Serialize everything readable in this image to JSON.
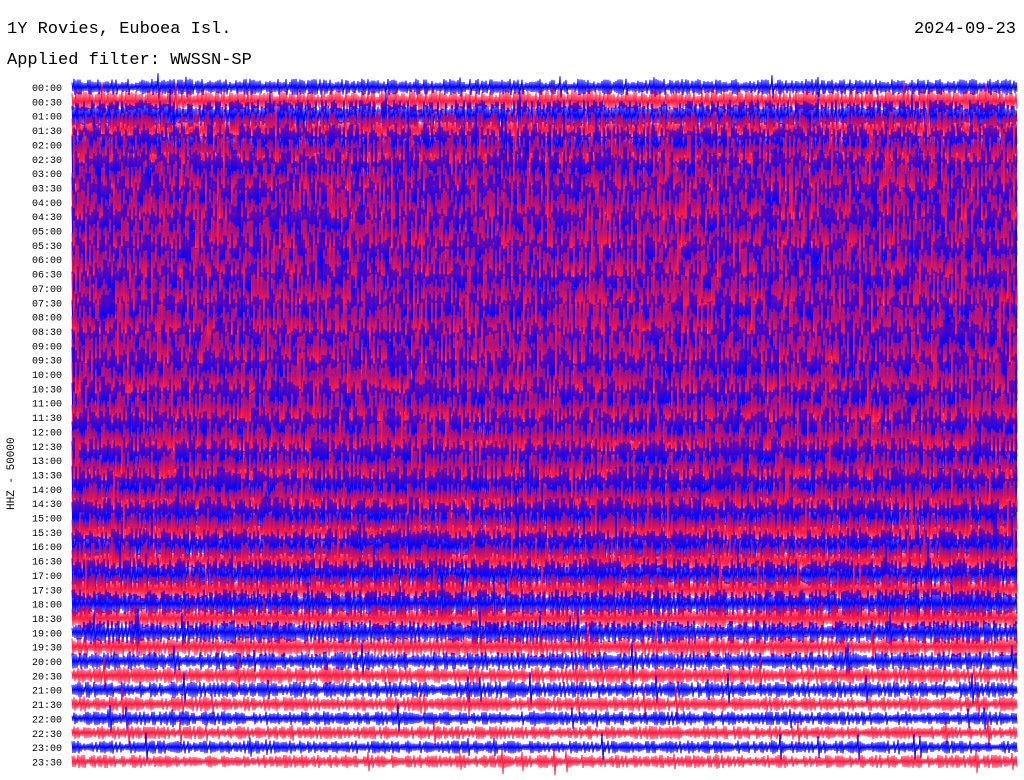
{
  "header": {
    "station": "1Y Rovies, Euboea Isl.",
    "date": "2024-09-23",
    "filter": "Applied filter: WWSSN-SP"
  },
  "chart_data": {
    "type": "line",
    "title": "1Y Rovies, Euboea Isl.",
    "subtitle": "Applied filter: WWSSN-SP",
    "ylabel": "HHZ - 50000",
    "xlabel": "",
    "row_labels": [
      "00:00",
      "00:30",
      "01:00",
      "01:30",
      "02:00",
      "02:30",
      "03:00",
      "03:30",
      "04:00",
      "04:30",
      "05:00",
      "05:30",
      "06:00",
      "06:30",
      "07:00",
      "07:30",
      "08:00",
      "08:30",
      "09:00",
      "09:30",
      "10:00",
      "10:30",
      "11:00",
      "11:30",
      "12:00",
      "12:30",
      "13:00",
      "13:30",
      "14:00",
      "14:30",
      "15:00",
      "15:30",
      "16:00",
      "16:30",
      "17:00",
      "17:30",
      "18:00",
      "18:30",
      "19:00",
      "19:30",
      "20:00",
      "20:30",
      "21:00",
      "21:30",
      "22:00",
      "22:30",
      "23:00",
      "23:30"
    ],
    "series_colors": [
      "#0000ff",
      "#ff1a40"
    ],
    "amplitude_profile": [
      0.2,
      0.35,
      0.5,
      0.6,
      0.7,
      0.8,
      0.9,
      0.95,
      1,
      1,
      1,
      1,
      1,
      1,
      1,
      1,
      1,
      1,
      1,
      1,
      1,
      0.95,
      0.9,
      0.9,
      0.85,
      0.85,
      0.8,
      0.8,
      0.8,
      0.75,
      0.7,
      0.65,
      0.6,
      0.6,
      0.55,
      0.5,
      0.45,
      0.4,
      0.35,
      0.3,
      0.25,
      0.22,
      0.2,
      0.18,
      0.16,
      0.15,
      0.14,
      0.14
    ],
    "grid": false
  }
}
